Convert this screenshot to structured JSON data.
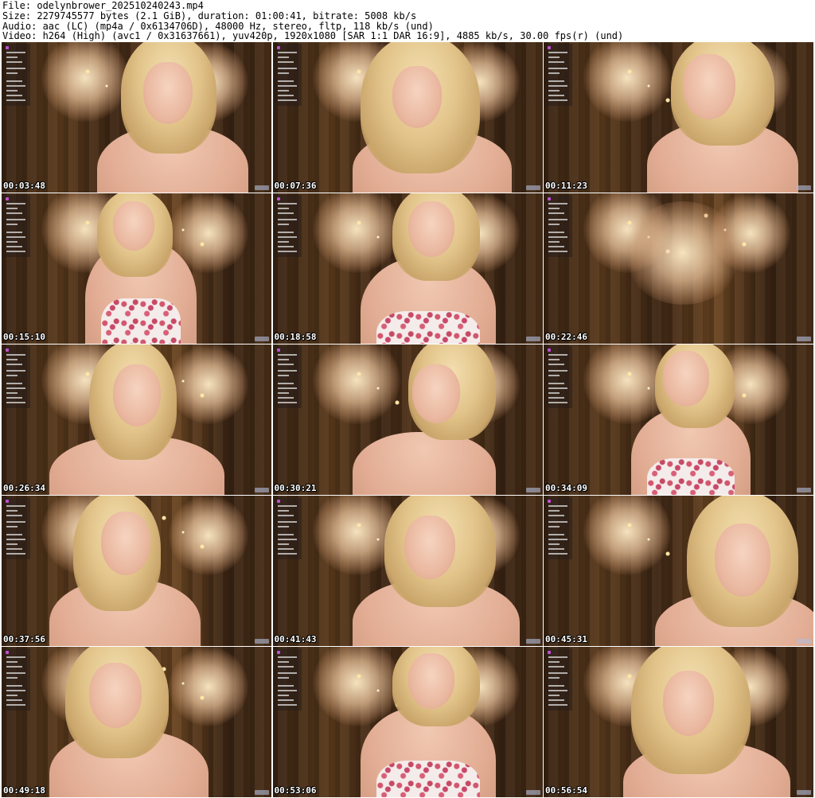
{
  "header": {
    "file_line": "File: odelynbrower_202510240243.mp4",
    "size_line": "Size: 2279745577 bytes (2.1 GiB), duration: 01:00:41, bitrate: 5008 kb/s",
    "audio_line": "Audio: aac (LC) (mp4a / 0x6134706D), 48000 Hz, stereo, fltp, 118 kb/s (und)",
    "video_line": "Video: h264 (High) (avc1 / 0x31637661), yuv420p, 1920x1080 [SAR 1:1 DAR 16:9], 4885 kb/s, 30.00 fps(r) (und)"
  },
  "thumbnails": [
    {
      "timestamp": "00:03:48",
      "dress_visible": false
    },
    {
      "timestamp": "00:07:36",
      "dress_visible": false
    },
    {
      "timestamp": "00:11:23",
      "dress_visible": false
    },
    {
      "timestamp": "00:15:10",
      "dress_visible": true
    },
    {
      "timestamp": "00:18:58",
      "dress_visible": true
    },
    {
      "timestamp": "00:22:46",
      "dress_visible": false
    },
    {
      "timestamp": "00:26:34",
      "dress_visible": false
    },
    {
      "timestamp": "00:30:21",
      "dress_visible": false
    },
    {
      "timestamp": "00:34:09",
      "dress_visible": true
    },
    {
      "timestamp": "00:37:56",
      "dress_visible": false
    },
    {
      "timestamp": "00:41:43",
      "dress_visible": false
    },
    {
      "timestamp": "00:45:31",
      "dress_visible": false
    },
    {
      "timestamp": "00:49:18",
      "dress_visible": false
    },
    {
      "timestamp": "00:53:06",
      "dress_visible": true
    },
    {
      "timestamp": "00:56:54",
      "dress_visible": false
    }
  ],
  "colors": {
    "background": "#ffffff",
    "header_text": "#000000",
    "timestamp_text": "#ffffff"
  }
}
